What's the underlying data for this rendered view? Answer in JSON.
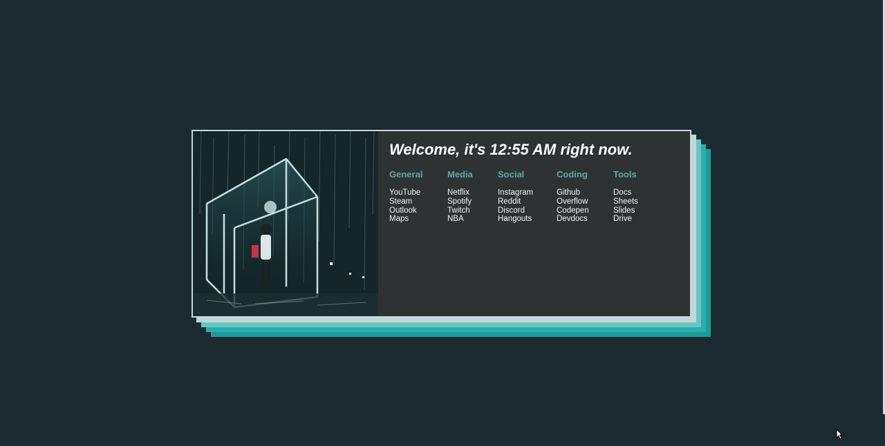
{
  "greeting": {
    "prefix": "Welcome, it's",
    "time": "12:55 AM",
    "suffix": "right now.",
    "full": "Welcome, it's 12:55 AM right now."
  },
  "colors": {
    "background": "#1b2b31",
    "card": "#2e3233",
    "accent": "#5fa8a8",
    "stack_teal": "#1d9a9a"
  },
  "categories": [
    {
      "title": "General",
      "links": [
        "YouTube",
        "Steam",
        "Outlook",
        "Maps"
      ]
    },
    {
      "title": "Media",
      "links": [
        "Netflix",
        "Spotify",
        "Twitch",
        "NBA"
      ]
    },
    {
      "title": "Social",
      "links": [
        "Instagram",
        "Reddit",
        "Discord",
        "Hangouts"
      ]
    },
    {
      "title": "Coding",
      "links": [
        "Github",
        "Overflow",
        "Codepen",
        "Devdocs"
      ]
    },
    {
      "title": "Tools",
      "links": [
        "Docs",
        "Sheets",
        "Slides",
        "Drive"
      ]
    }
  ],
  "hero_image": {
    "icon": "rainy-night-glass-booth-illustration"
  },
  "cursor": {
    "icon": "mouse-pointer-icon"
  }
}
